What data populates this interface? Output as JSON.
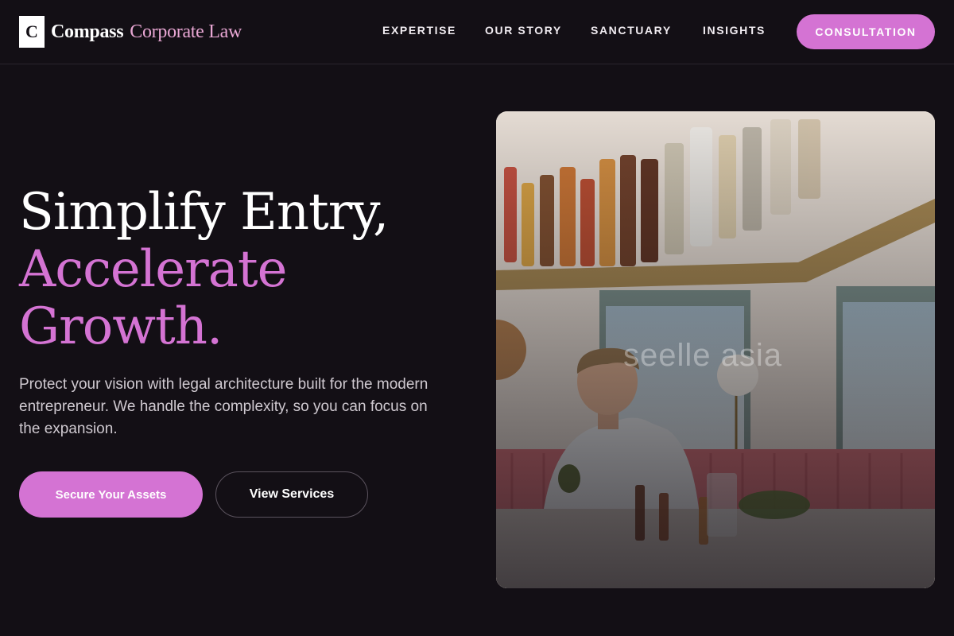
{
  "brand": {
    "mark": "C",
    "name": "Compass",
    "sub": "Corporate Law"
  },
  "nav": {
    "links": [
      "EXPERTISE",
      "OUR STORY",
      "SANCTUARY",
      "INSIGHTS"
    ],
    "cta": "CONSULTATION"
  },
  "hero": {
    "title_line1": "Simplify Entry,",
    "title_line2": "Accelerate",
    "title_line3": "Growth.",
    "text": "Protect your vision with legal architecture built for the modern entrepreneur. We handle the complexity, so you can focus on the expansion.",
    "primary_button": "Secure Your Assets",
    "secondary_button": "View Services"
  },
  "image": {
    "watermark": "seelle asia"
  },
  "colors": {
    "background": "#130f15",
    "accent": "#d473d3",
    "brand_sub": "#e9a7d4"
  }
}
